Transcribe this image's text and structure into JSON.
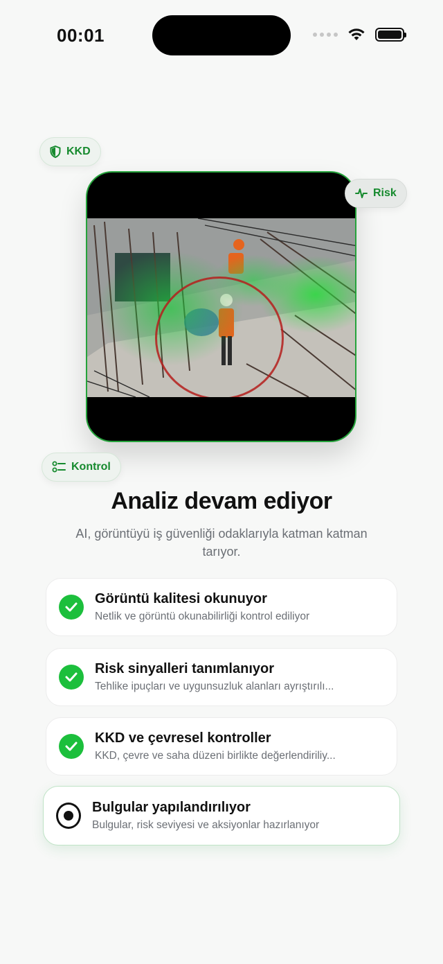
{
  "status_bar": {
    "time": "00:01"
  },
  "chips": {
    "kkd": "KKD",
    "risk": "Risk",
    "kontrol": "Kontrol"
  },
  "main": {
    "title": "Analiz devam ediyor",
    "subtitle": "AI, görüntüyü iş güvenliği odaklarıyla katman katman tarıyor."
  },
  "steps": [
    {
      "title": "Görüntü kalitesi okunuyor",
      "desc": "Netlik ve görüntü okunabilirliği kontrol ediliyor",
      "state": "done"
    },
    {
      "title": "Risk sinyalleri tanımlanıyor",
      "desc": "Tehlike ipuçları ve uygunsuzluk alanları ayrıştırılı...",
      "state": "done"
    },
    {
      "title": "KKD ve çevresel kontroller",
      "desc": "KKD, çevre ve saha düzeni birlikte değerlendiriliy...",
      "state": "done"
    },
    {
      "title": "Bulgular yapılandırılıyor",
      "desc": "Bulgular, risk seviyesi ve aksiyonlar hazırlanıyor",
      "state": "active"
    }
  ],
  "colors": {
    "accent": "#1cbf3c",
    "chip_text": "#168a2e",
    "risk_ring": "#b51f1c"
  }
}
